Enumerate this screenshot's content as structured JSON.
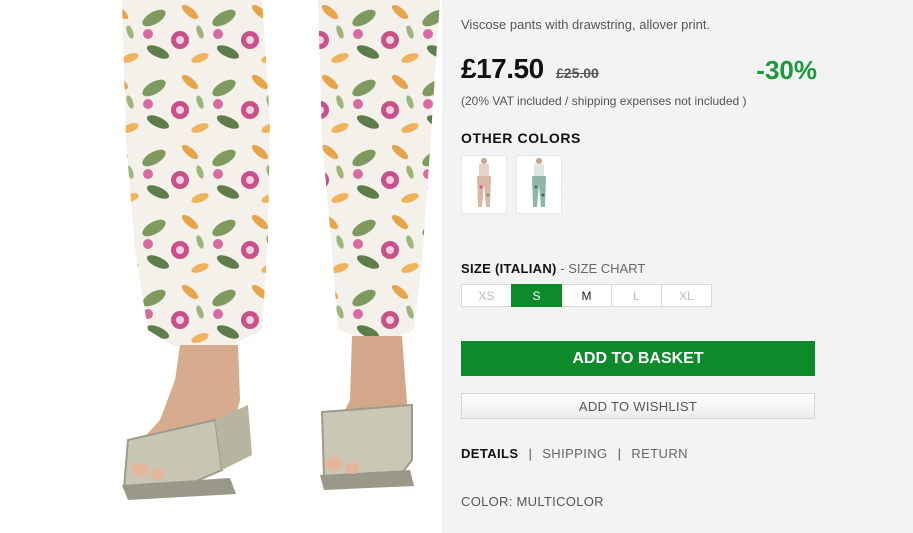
{
  "product": {
    "description": "Viscose pants with drawstring, allover print.",
    "price": "£17.50",
    "old_price": "£25.00",
    "discount": "-30%",
    "vat_note": "(20% VAT included / shipping expenses not included )"
  },
  "other_colors": {
    "title": "OTHER COLORS",
    "swatches": [
      {
        "name": "floral-print",
        "color": "#d9b8a8"
      },
      {
        "name": "green-print",
        "color": "#8fb5a8"
      }
    ]
  },
  "size": {
    "title": "SIZE (ITALIAN)",
    "separator": " - ",
    "chart_link": "SIZE CHART",
    "options": [
      {
        "label": "XS",
        "available": false,
        "selected": false
      },
      {
        "label": "S",
        "available": true,
        "selected": true
      },
      {
        "label": "M",
        "available": true,
        "selected": false
      },
      {
        "label": "L",
        "available": false,
        "selected": false
      },
      {
        "label": "XL",
        "available": false,
        "selected": false
      }
    ]
  },
  "actions": {
    "add_to_basket": "ADD TO BASKET",
    "add_to_wishlist": "ADD TO WISHLIST"
  },
  "info_tabs": {
    "details": "DETAILS",
    "shipping": "SHIPPING",
    "return": "RETURN",
    "separator": "|"
  },
  "color_line": "COLOR: MULTICOLOR",
  "theme": {
    "accent_green": "#0d8a2a",
    "discount_green": "#1b9a3a",
    "panel_bg": "#f3f3f3"
  }
}
